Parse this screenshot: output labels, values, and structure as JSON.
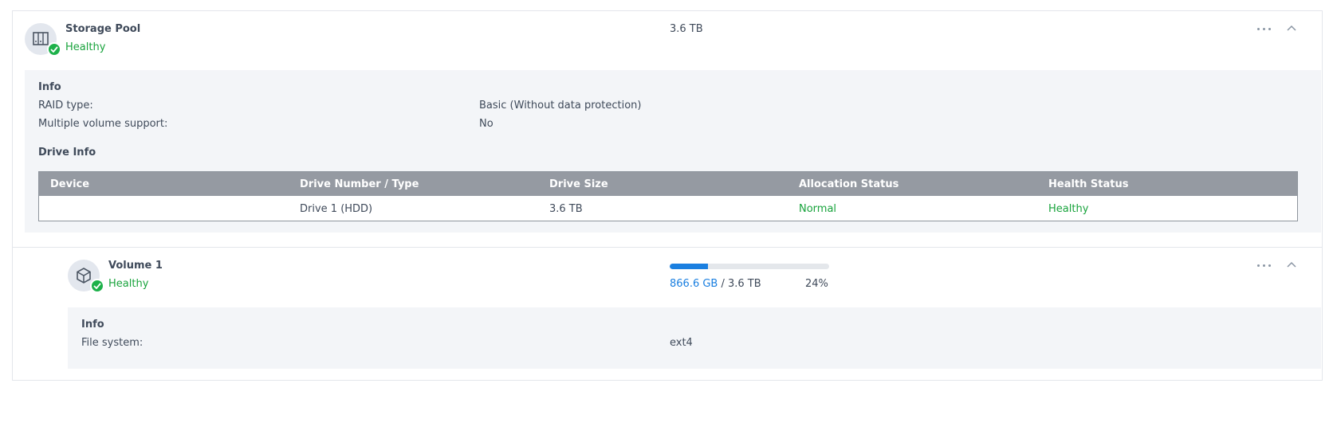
{
  "storage_pool": {
    "title": "Storage Pool",
    "status": "Healthy",
    "capacity": "3.6 TB",
    "info": {
      "section_title": "Info",
      "raid_label": "RAID type:",
      "raid_value": "Basic (Without data protection)",
      "multi_label": "Multiple volume support:",
      "multi_value": "No"
    },
    "drive_info": {
      "section_title": "Drive Info",
      "columns": [
        "Device",
        "Drive Number / Type",
        "Drive Size",
        "Allocation Status",
        "Health Status"
      ],
      "rows": [
        {
          "device": "",
          "drive": "Drive 1 (HDD)",
          "size": "3.6 TB",
          "allocation": "Normal",
          "health": "Healthy"
        }
      ]
    }
  },
  "volume": {
    "title": "Volume 1",
    "status": "Healthy",
    "used": "866.6 GB",
    "separator": " / ",
    "total": "3.6 TB",
    "percent_label": "24%",
    "usage_fraction": 0.24,
    "info": {
      "section_title": "Info",
      "fs_label": "File system:",
      "fs_value": "ext4"
    }
  },
  "icons": {
    "pool": "storage-pool-icon",
    "volume": "cube-volume-icon",
    "status": "check-icon",
    "more": "more-icon",
    "collapse": "chevron-up-icon"
  },
  "colors": {
    "healthy": "#18a33c",
    "accent": "#1a7fe0",
    "table_header": "#959aa2"
  }
}
